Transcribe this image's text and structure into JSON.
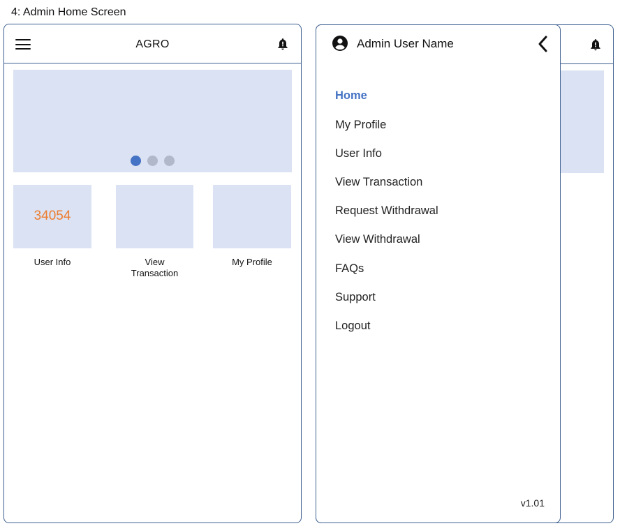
{
  "page": {
    "title": "4: Admin Home Screen"
  },
  "home": {
    "app_title": "AGRO",
    "icons": {
      "menu": "hamburger-icon",
      "notifications": "bell-icon"
    },
    "carousel": {
      "dot_count": 3,
      "active_index": 0
    },
    "tiles": [
      {
        "value": "34054",
        "label": "User Info"
      },
      {
        "value": "",
        "label": "View Transaction"
      },
      {
        "value": "",
        "label": "My Profile"
      }
    ]
  },
  "drawer": {
    "user_name": "Admin User Name",
    "icons": {
      "user": "account-circle-icon",
      "close": "chevron-left-icon"
    },
    "items": [
      {
        "label": "Home",
        "active": true
      },
      {
        "label": "My Profile",
        "active": false
      },
      {
        "label": "User Info",
        "active": false
      },
      {
        "label": "View Transaction",
        "active": false
      },
      {
        "label": "Request Withdrawal",
        "active": false
      },
      {
        "label": "View Withdrawal",
        "active": false
      },
      {
        "label": "FAQs",
        "active": false
      },
      {
        "label": "Support",
        "active": false
      },
      {
        "label": "Logout",
        "active": false
      }
    ],
    "version": "v1.01"
  },
  "colors": {
    "border": "#3d5f8f",
    "placeholder": "#dae2f3",
    "accent": "#4472c4",
    "highlight_number": "#ed7d31",
    "inactive_dot": "#b0b8c9"
  }
}
